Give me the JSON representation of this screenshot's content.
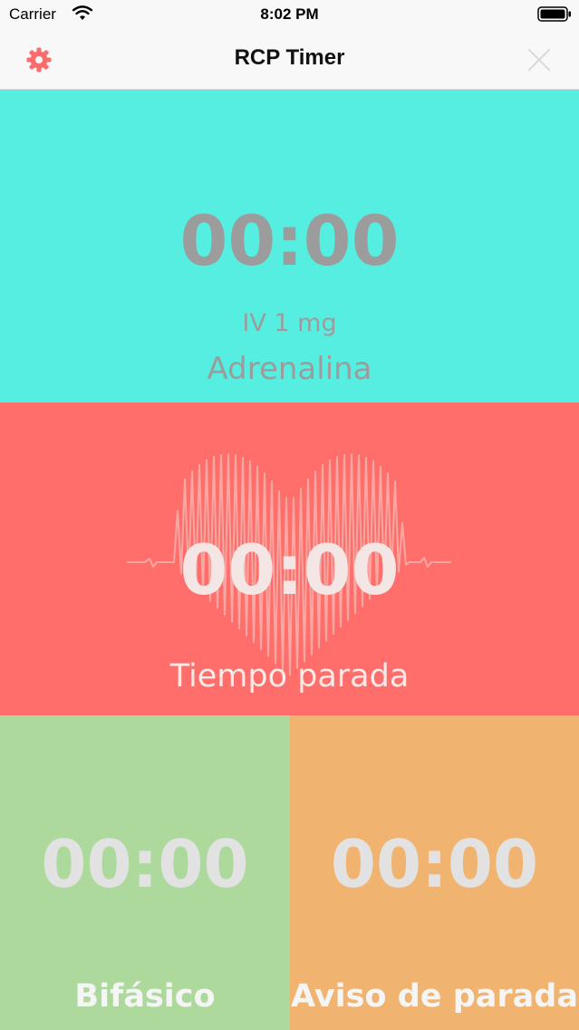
{
  "status_bar": {
    "carrier": "Carrier",
    "time": "8:02 PM",
    "wifi_icon": "wifi-icon",
    "battery_icon": "battery-icon"
  },
  "nav": {
    "title": "RCP Timer",
    "settings_icon": "gear-icon",
    "close_icon": "close-icon"
  },
  "panels": {
    "adrenalina": {
      "time": "00:00",
      "dose": "IV 1 mg",
      "label": "Adrenalina",
      "color": "#56eee0"
    },
    "tiempo_parada": {
      "time": "00:00",
      "label": "Tiempo parada",
      "color": "#ff6e6a",
      "background_icon": "heartbeat-heart-icon"
    },
    "bifasico": {
      "time": "00:00",
      "label": "Bifásico",
      "color": "#aed99d"
    },
    "aviso_parada": {
      "time": "00:00",
      "label": "Aviso de parada",
      "color": "#f1b470"
    }
  },
  "colors": {
    "accent": "#fb6b6b",
    "nav_background": "#f8f8f8"
  }
}
